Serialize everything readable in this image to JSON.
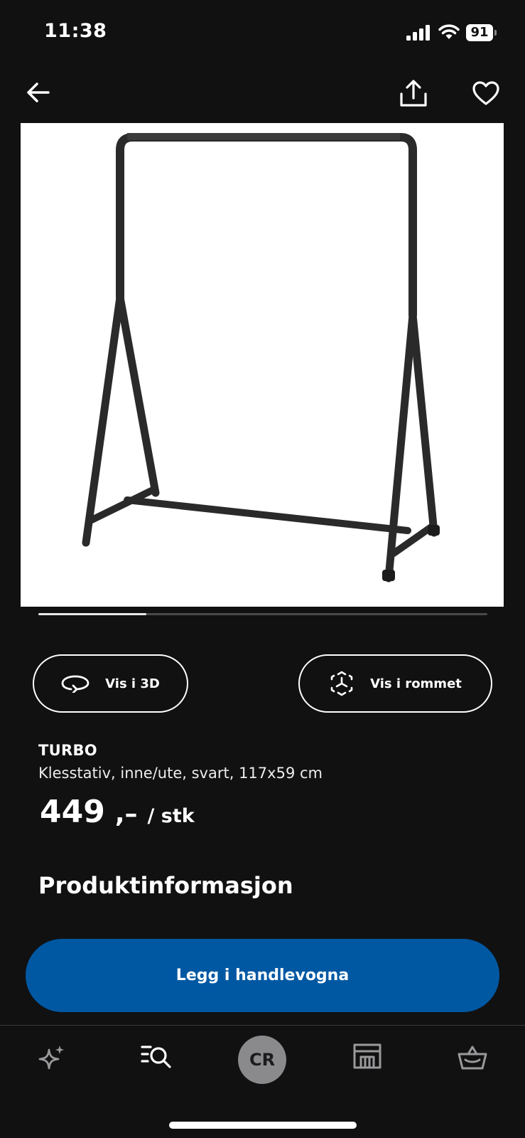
{
  "status_bar": {
    "time": "11:38",
    "battery": "91"
  },
  "product": {
    "name": "TURBO",
    "description": "Klesstativ, inne/ute, svart, 117x59 cm",
    "price": "449",
    "price_suffix": ",–",
    "price_unit": "/ stk",
    "image_progress": 0.24
  },
  "actions": {
    "view_3d": "Vis i 3D",
    "view_in_room": "Vis i rommet",
    "add_to_cart": "Legg i handlevogna"
  },
  "section_heading": "Produktinformasjon",
  "tabbar": {
    "profile_initials": "CR"
  },
  "colors": {
    "accent": "#0058a3",
    "background": "#111112"
  }
}
